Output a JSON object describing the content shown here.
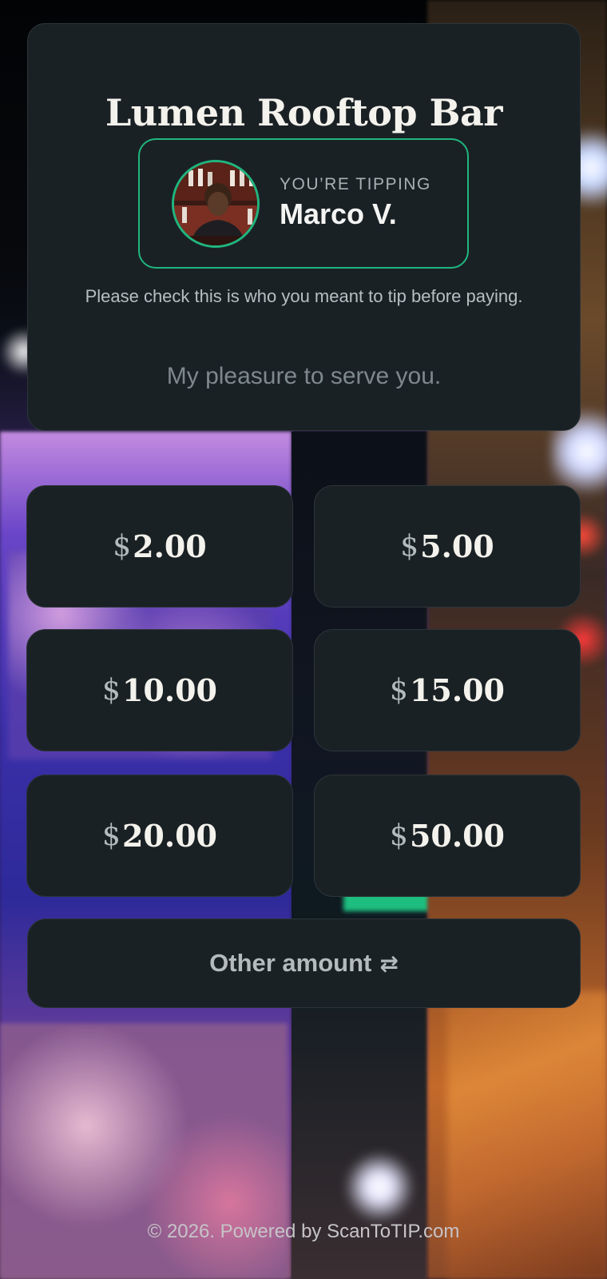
{
  "venue": {
    "name": "Lumen Rooftop Bar"
  },
  "tippee": {
    "label": "YOU’RE TIPPING",
    "name": "Marco V.",
    "avatar_icon": "person-photo",
    "accent": "#1fb67f"
  },
  "notice": {
    "check_text": "Please check this is who you meant to tip before paying.",
    "message": "My pleasure to serve you."
  },
  "tips": {
    "currency": "$",
    "amounts": [
      "2.00",
      "5.00",
      "10.00",
      "15.00",
      "20.00",
      "50.00"
    ]
  },
  "other": {
    "label": "Other amount",
    "icon": "⇄"
  },
  "footer": {
    "text": "© 2026. Powered by ScanToTIP.com"
  }
}
